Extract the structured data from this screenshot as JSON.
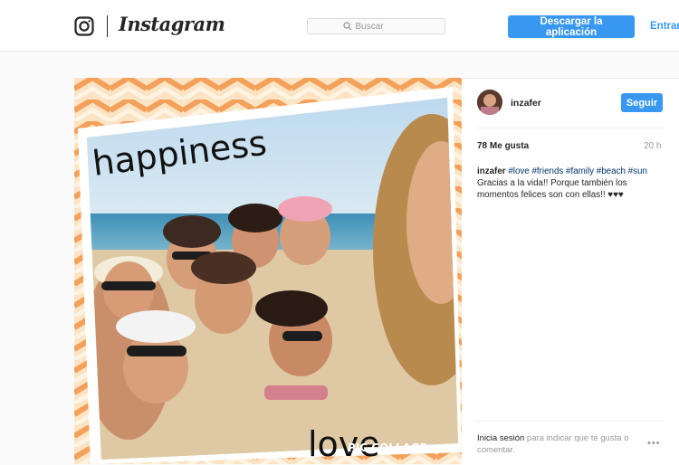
{
  "nav": {
    "wordmark": "Instagram",
    "search_placeholder": "Buscar",
    "download_label": "Descargar la aplicación",
    "login_label": "Entrar"
  },
  "post": {
    "photo_text": {
      "top": "happiness",
      "bottom": "love",
      "watermark": "PIC COLLAGE"
    },
    "username": "inzafer",
    "follow_label": "Seguir",
    "likes": "78 Me gusta",
    "time": "20 h",
    "caption": {
      "user": "inzafer",
      "hashtags": "#love #friends #family #beach #sun",
      "text": "Gracias a la vida!! Porque también los momentos felices son con ellas!! ♥♥♥"
    },
    "login_prompt": {
      "link": "Inicia sesión",
      "text": "para indicar que te gusta o comentar."
    },
    "more": "•••"
  },
  "colors": {
    "accent": "#3897f0",
    "chevron_orange": "#f3a15a",
    "chevron_light": "#fbe3c4"
  }
}
